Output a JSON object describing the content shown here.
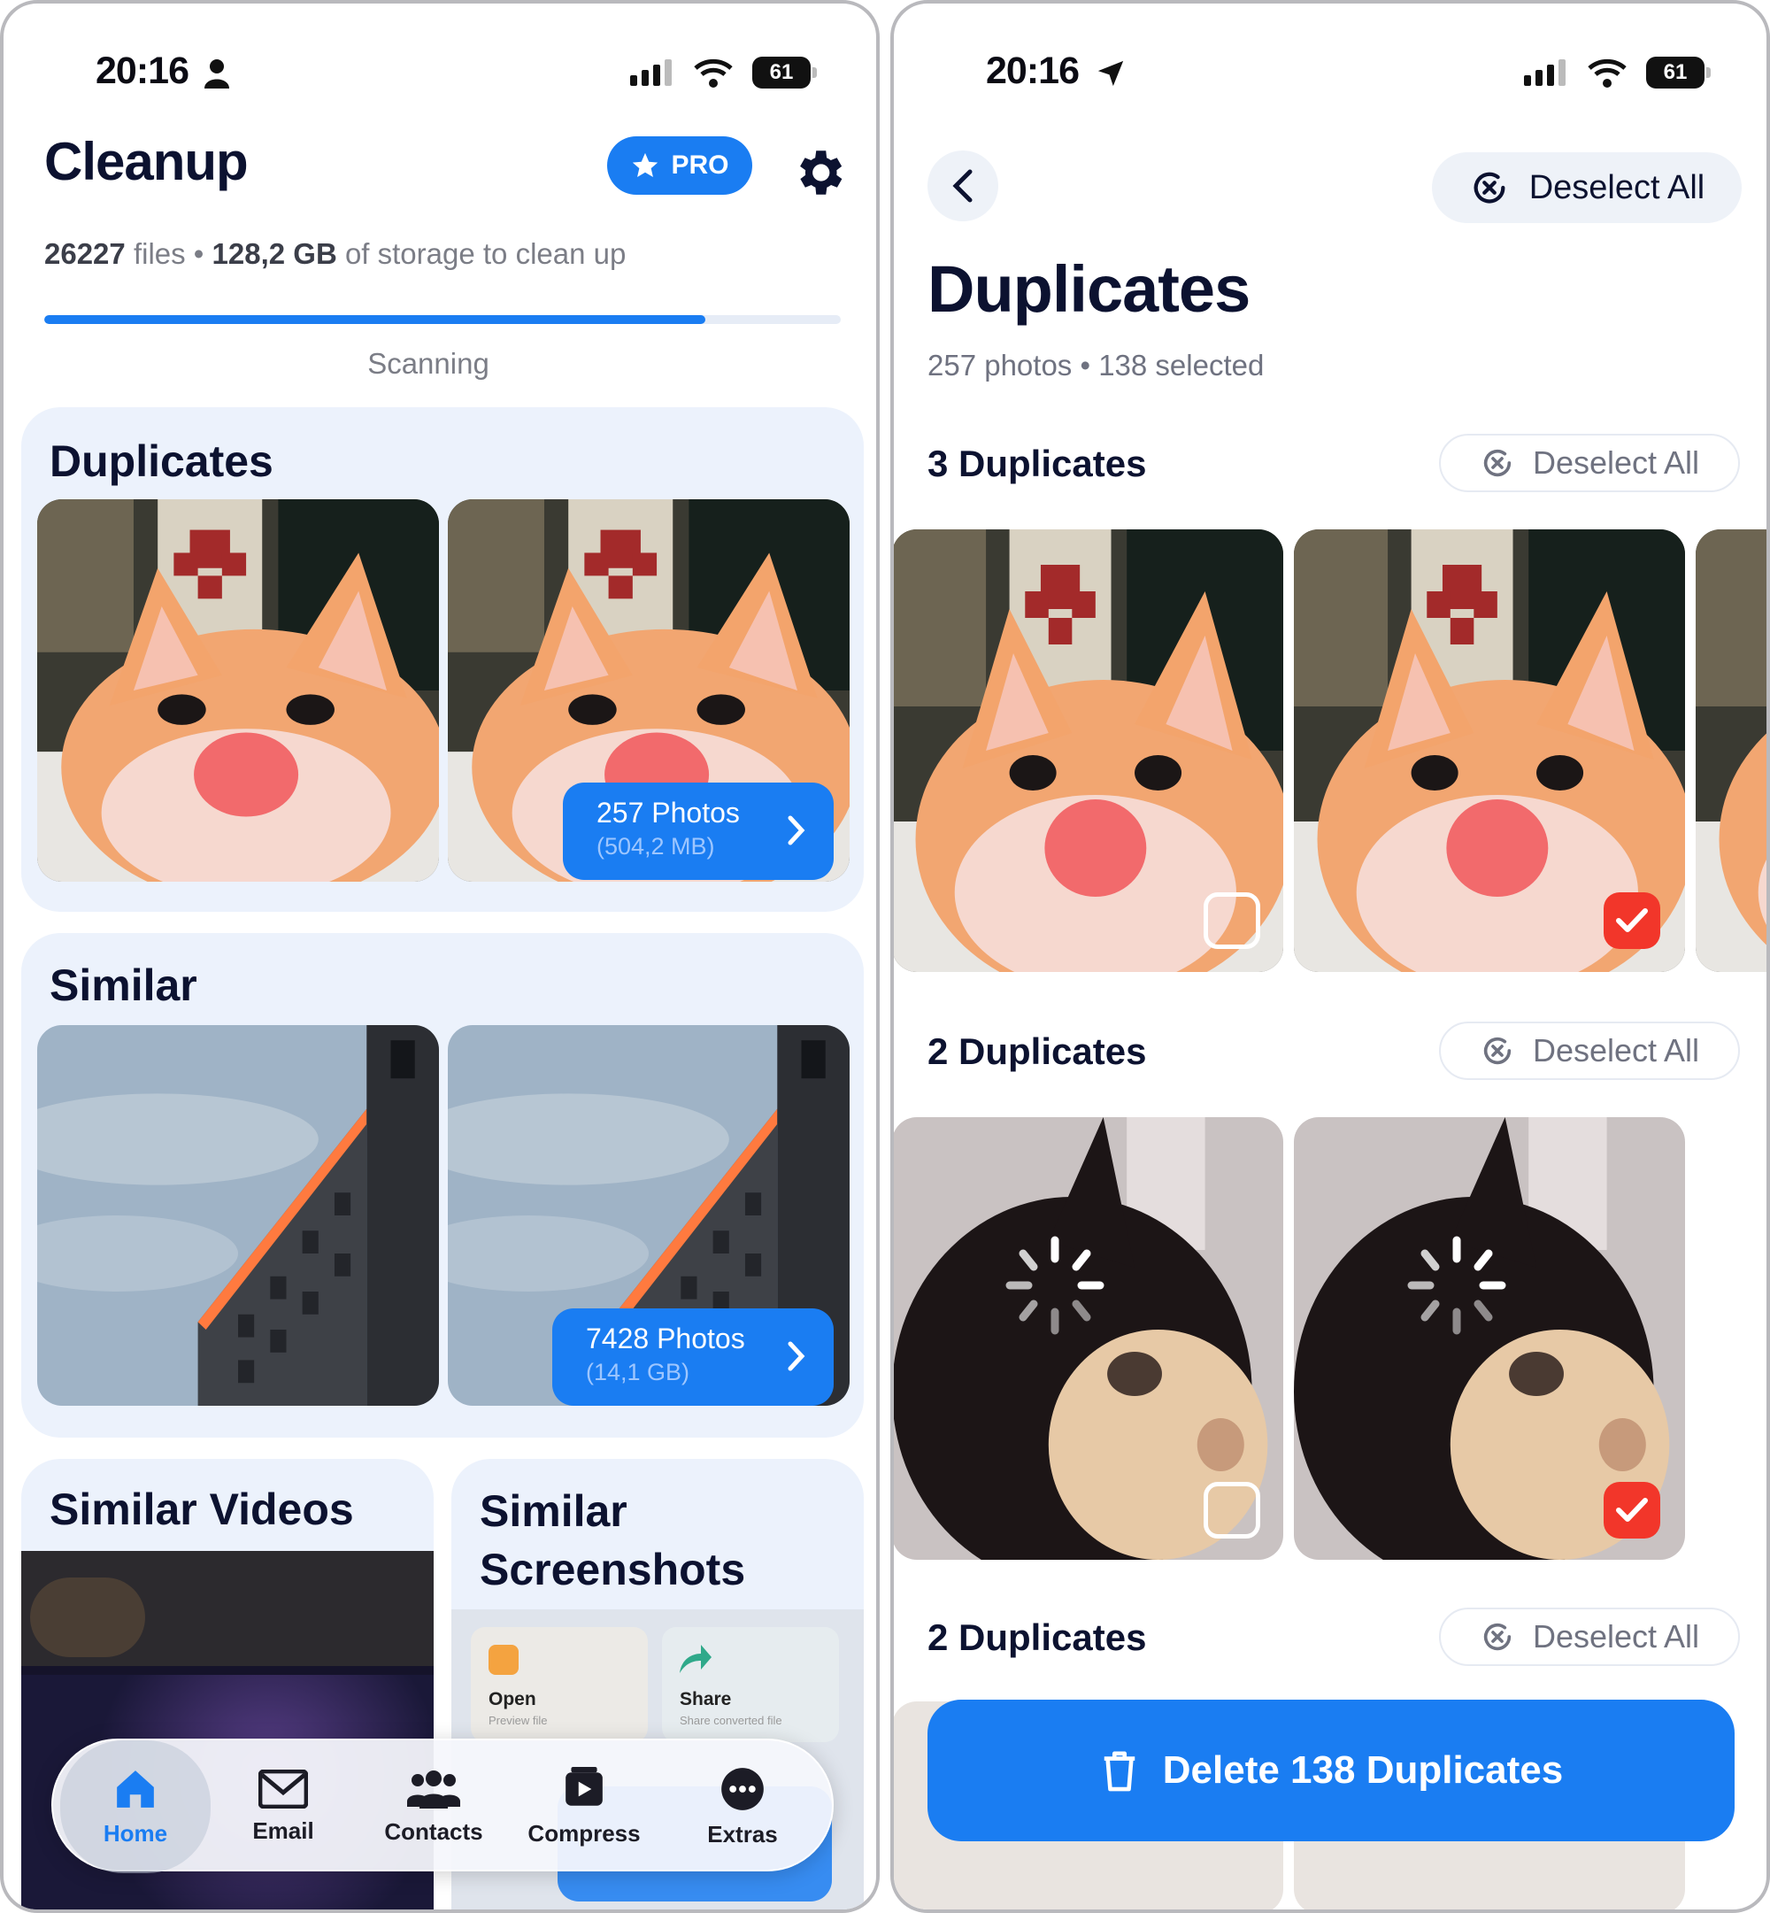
{
  "left": {
    "status": {
      "time": "20:16",
      "battery": "61"
    },
    "header": {
      "title": "Cleanup",
      "pro_label": "PRO"
    },
    "storage": {
      "files_count": "26227",
      "files_word": "files",
      "sep": "•",
      "size": "128,2 GB",
      "rest": "of storage to clean up"
    },
    "progress": {
      "fraction": 0.83,
      "label": "Scanning"
    },
    "duplicates_card": {
      "title": "Duplicates",
      "count": "257 Photos",
      "size": "(504,2 MB)"
    },
    "similar_card": {
      "title": "Similar",
      "count": "7428 Photos",
      "size": "(14,1 GB)"
    },
    "videos_card": {
      "title": "Similar Videos"
    },
    "screenshots_card": {
      "title": "Similar Screenshots",
      "open_label": "Open",
      "open_sub": "Preview file",
      "share_label": "Share",
      "share_sub": "Share converted file"
    },
    "tabbar": {
      "items": [
        {
          "label": "Home",
          "icon": "house-icon",
          "active": true
        },
        {
          "label": "Email",
          "icon": "envelope-icon"
        },
        {
          "label": "Contacts",
          "icon": "people-icon"
        },
        {
          "label": "Compress",
          "icon": "video-icon"
        },
        {
          "label": "Extras",
          "icon": "ellipsis-icon"
        }
      ]
    }
  },
  "right": {
    "status": {
      "time": "20:16",
      "battery": "61"
    },
    "deselect_all": "Deselect All",
    "title": "Duplicates",
    "subtitle": "257 photos • 138 selected",
    "groups": [
      {
        "title": "3 Duplicates",
        "deselect": "Deselect All"
      },
      {
        "title": "2 Duplicates",
        "deselect": "Deselect All"
      },
      {
        "title": "2 Duplicates",
        "deselect": "Deselect All"
      }
    ],
    "delete_button": "Delete 138 Duplicates"
  },
  "colors": {
    "accent": "#1a7df2",
    "danger": "#f2362a",
    "card": "#ecf2fc"
  }
}
